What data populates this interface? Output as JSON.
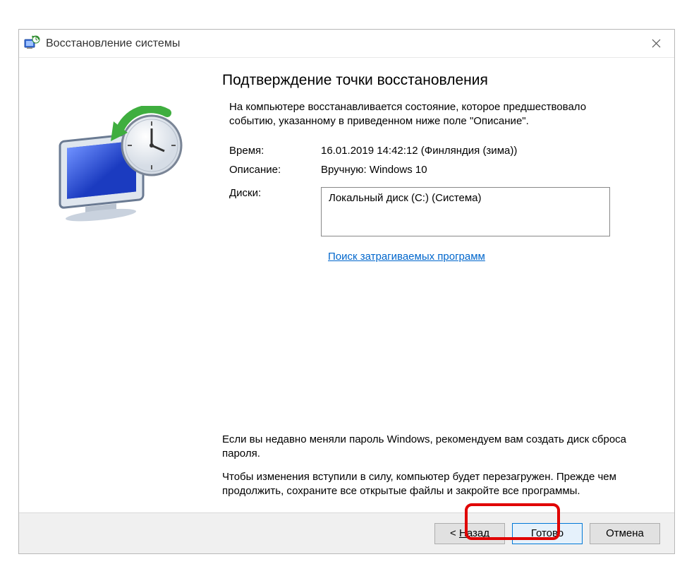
{
  "titlebar": {
    "title": "Восстановление системы"
  },
  "main": {
    "heading": "Подтверждение точки восстановления",
    "intro": "На компьютере восстанавливается состояние, которое предшествовало событию, указанному в приведенном ниже поле \"Описание\".",
    "time_label": "Время:",
    "time_value": "16.01.2019 14:42:12 (Финляндия (зима))",
    "desc_label": "Описание:",
    "desc_value": "Вручную: Windows 10",
    "disks_label": "Диски:",
    "disks_value": "Локальный диск (C:) (Система)",
    "link": "Поиск затрагиваемых программ",
    "note1": "Если вы недавно меняли пароль Windows, рекомендуем вам создать диск сброса пароля.",
    "note2": "Чтобы изменения вступили в силу, компьютер будет перезагружен. Прежде чем продолжить, сохраните все открытые файлы и закройте все программы."
  },
  "buttons": {
    "back_prefix": "< ",
    "back_key": "Н",
    "back_suffix": "азад",
    "finish": "Готово",
    "cancel": "Отмена"
  }
}
